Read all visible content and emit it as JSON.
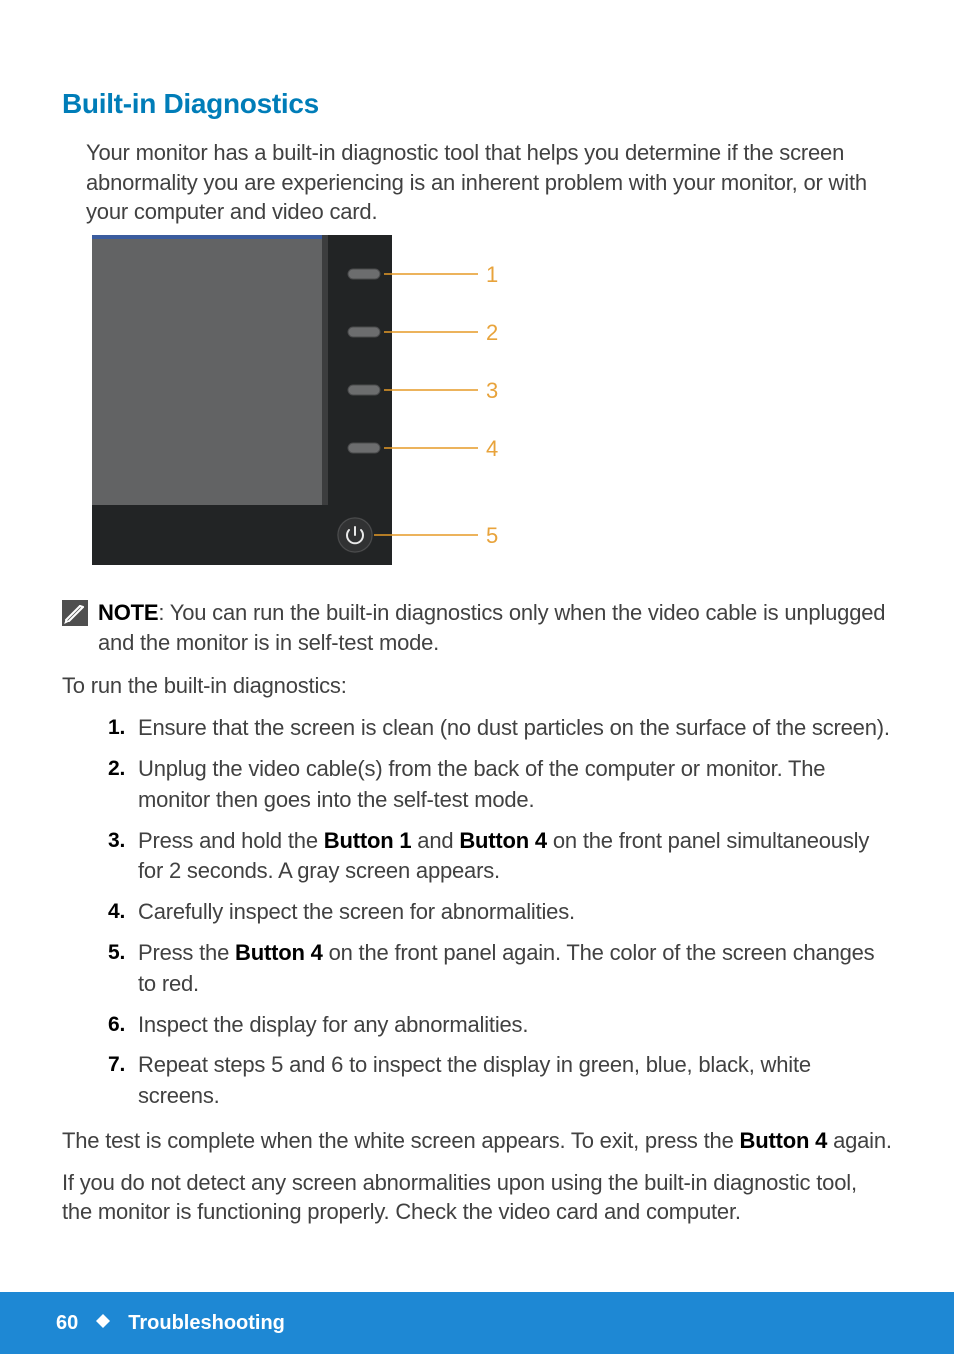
{
  "heading": "Built-in Diagnostics",
  "intro": "Your monitor has a built-in diagnostic tool that helps you determine if the screen abnormality you are experiencing is an inherent problem with your monitor, or with your computer and video card.",
  "diagram": {
    "labels": [
      "1",
      "2",
      "3",
      "4",
      "5"
    ]
  },
  "note": {
    "label": "NOTE",
    "text_after_label": ": You can run the built-in diagnostics only when the video cable is unplugged and the monitor is in self-test mode."
  },
  "pre_steps": "To run the built-in diagnostics:",
  "steps": [
    {
      "n": "1.",
      "segments": [
        {
          "t": "Ensure that the screen is clean (no dust particles on the surface of the screen)."
        }
      ]
    },
    {
      "n": "2.",
      "segments": [
        {
          "t": "Unplug the video cable(s) from the back of the computer or monitor. The monitor then goes into the self-test mode."
        }
      ]
    },
    {
      "n": "3.",
      "segments": [
        {
          "t": "Press and hold the "
        },
        {
          "t": "Button 1",
          "b": true
        },
        {
          "t": " and "
        },
        {
          "t": "Button 4",
          "b": true
        },
        {
          "t": " on the front panel simultaneously for 2 seconds. A gray screen appears."
        }
      ]
    },
    {
      "n": "4.",
      "segments": [
        {
          "t": "Carefully inspect the screen for abnormalities."
        }
      ]
    },
    {
      "n": "5.",
      "segments": [
        {
          "t": "Press the "
        },
        {
          "t": "Button 4",
          "b": true
        },
        {
          "t": " on the front panel again. The color of the screen changes to red."
        }
      ]
    },
    {
      "n": "6.",
      "segments": [
        {
          "t": "Inspect the display for any abnormalities."
        }
      ]
    },
    {
      "n": "7.",
      "segments": [
        {
          "t": "Repeat steps 5 and 6 to inspect the display in green, blue, black, white screens."
        }
      ]
    }
  ],
  "post1": {
    "segments": [
      {
        "t": "The test is complete when the white screen appears. To exit, press the "
      },
      {
        "t": "Button 4",
        "b": true
      },
      {
        "t": " again."
      }
    ]
  },
  "post2": "If you do not detect any screen abnormalities upon using the built-in diagnostic tool, the monitor is functioning properly. Check the video card and computer.",
  "footer": {
    "page": "60",
    "section": "Troubleshooting"
  }
}
